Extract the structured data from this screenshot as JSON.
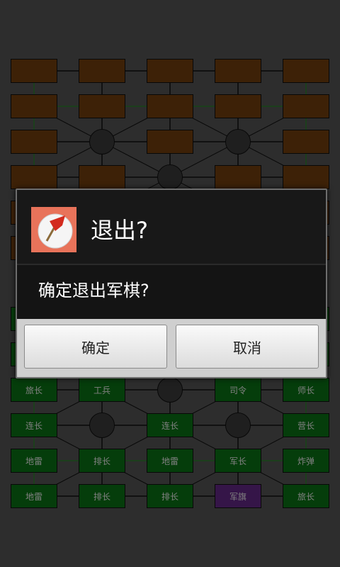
{
  "colors": {
    "background": "#5a5a5a",
    "hidden_piece": "#7a430e",
    "own_piece": "#0b7a17",
    "flag_piece": "#6b2a90",
    "camp": "#3e3e3e",
    "rail_line": "#2f8a2f",
    "road_line": "#111111"
  },
  "board": {
    "top_rows": [
      [
        "hidden",
        "hidden",
        "hidden",
        "hidden",
        "hidden"
      ],
      [
        "hidden",
        "hidden",
        "hidden",
        "hidden",
        "hidden"
      ],
      [
        "hidden",
        "camp",
        "hidden",
        "camp",
        "hidden"
      ],
      [
        "hidden",
        "hidden",
        "camp",
        "hidden",
        "hidden"
      ],
      [
        "hidden",
        "camp",
        "hidden",
        "camp",
        "hidden"
      ],
      [
        "hidden",
        "hidden",
        "hidden",
        "hidden",
        "hidden"
      ]
    ],
    "bottom_rows": [
      [
        "green",
        "green",
        "green",
        "green",
        "green"
      ],
      [
        "green",
        "green",
        "green",
        "green",
        "green"
      ],
      [
        "旅长",
        "工兵",
        "camp",
        "司令",
        "师长"
      ],
      [
        "连长",
        "camp",
        "连长",
        "camp",
        "营长"
      ],
      [
        "地雷",
        "排长",
        "地雷",
        "军长",
        "炸弹"
      ],
      [
        "地雷",
        "排长",
        "排长",
        "军旗",
        "旅长"
      ]
    ]
  },
  "dialog": {
    "icon": "red-flag-icon",
    "title": "退出?",
    "message": "确定退出军棋?",
    "ok_label": "确定",
    "cancel_label": "取消"
  }
}
